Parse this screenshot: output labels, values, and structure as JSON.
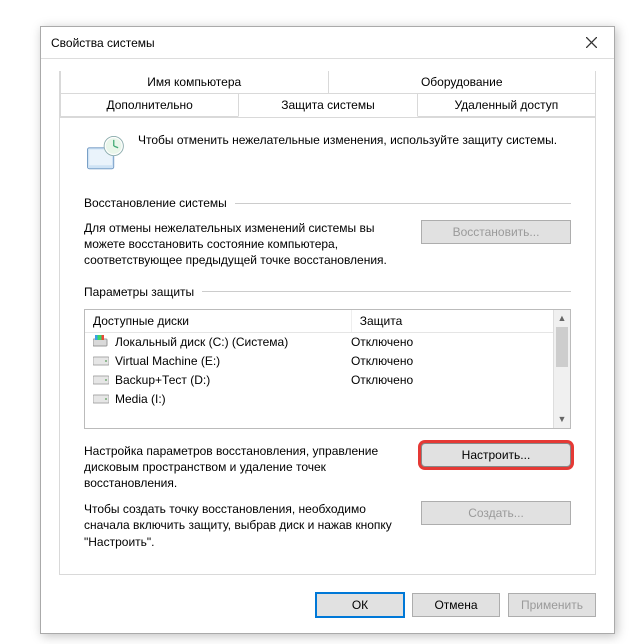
{
  "title": "Свойства системы",
  "tabs": {
    "row1": [
      "Имя компьютера",
      "Оборудование"
    ],
    "row2": [
      "Дополнительно",
      "Защита системы",
      "Удаленный доступ"
    ],
    "active": "Защита системы"
  },
  "intro": "Чтобы отменить нежелательные изменения, используйте защиту системы.",
  "restore": {
    "heading": "Восстановление системы",
    "text": "Для отмены нежелательных изменений системы вы можете восстановить состояние компьютера, соответствующее предыдущей точке восстановления.",
    "button": "Восстановить..."
  },
  "protection": {
    "heading": "Параметры защиты",
    "columns": [
      "Доступные диски",
      "Защита"
    ],
    "rows": [
      {
        "name": "Локальный диск (C:) (Система)",
        "status": "Отключено",
        "type": "system"
      },
      {
        "name": "Virtual Machine (E:)",
        "status": "Отключено",
        "type": "drive"
      },
      {
        "name": "Backup+Тест (D:)",
        "status": "Отключено",
        "type": "drive"
      },
      {
        "name": "Media (I:)",
        "status": "",
        "type": "drive"
      }
    ],
    "configureText": "Настройка параметров восстановления, управление дисковым пространством и удаление точек восстановления.",
    "configureButton": "Настроить...",
    "createText": "Чтобы создать точку восстановления, необходимо сначала включить защиту, выбрав диск и нажав кнопку \"Настроить\".",
    "createButton": "Создать..."
  },
  "footer": {
    "ok": "ОК",
    "cancel": "Отмена",
    "apply": "Применить"
  }
}
